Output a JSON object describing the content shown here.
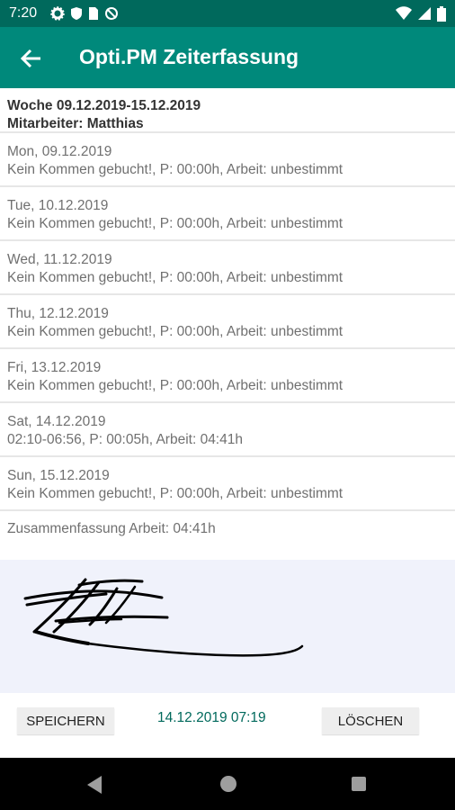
{
  "status_bar": {
    "time": "7:20",
    "left_icons": [
      "settings-icon",
      "shield-icon",
      "sim-card-icon",
      "no-sync-icon"
    ],
    "right_icons": [
      "wifi-icon",
      "signal-icon",
      "battery-icon"
    ]
  },
  "app_bar": {
    "title": "Opti.PM Zeiterfassung",
    "background": "#00897b",
    "status_background": "#00695c"
  },
  "week": {
    "range": "Woche 09.12.2019-15.12.2019",
    "employee": "Mitarbeiter: Matthias"
  },
  "days": [
    {
      "date": "Mon, 09.12.2019",
      "detail": "Kein Kommen gebucht!, P: 00:00h, Arbeit: unbestimmt"
    },
    {
      "date": "Tue, 10.12.2019",
      "detail": "Kein Kommen gebucht!, P: 00:00h, Arbeit: unbestimmt"
    },
    {
      "date": "Wed, 11.12.2019",
      "detail": "Kein Kommen gebucht!, P: 00:00h, Arbeit: unbestimmt"
    },
    {
      "date": "Thu, 12.12.2019",
      "detail": "Kein Kommen gebucht!, P: 00:00h, Arbeit: unbestimmt"
    },
    {
      "date": "Fri, 13.12.2019",
      "detail": "Kein Kommen gebucht!, P: 00:00h, Arbeit: unbestimmt"
    },
    {
      "date": "Sat, 14.12.2019",
      "detail": "02:10-06:56, P: 00:05h, Arbeit: 04:41h"
    },
    {
      "date": "Sun, 15.12.2019",
      "detail": "Kein Kommen gebucht!, P: 00:00h, Arbeit: unbestimmt"
    }
  ],
  "summary": "Zusammenfassung Arbeit: 04:41h",
  "signature_pad": {
    "background": "#f0f2fb",
    "ink_color": "#000000"
  },
  "footer": {
    "save_label": "SPEICHERN",
    "timestamp": "14.12.2019 07:19",
    "delete_label": "LÖSCHEN",
    "timestamp_color": "#00695c"
  },
  "nav_bar": {
    "icons": [
      "back-triangle-icon",
      "home-circle-icon",
      "recents-square-icon"
    ]
  }
}
